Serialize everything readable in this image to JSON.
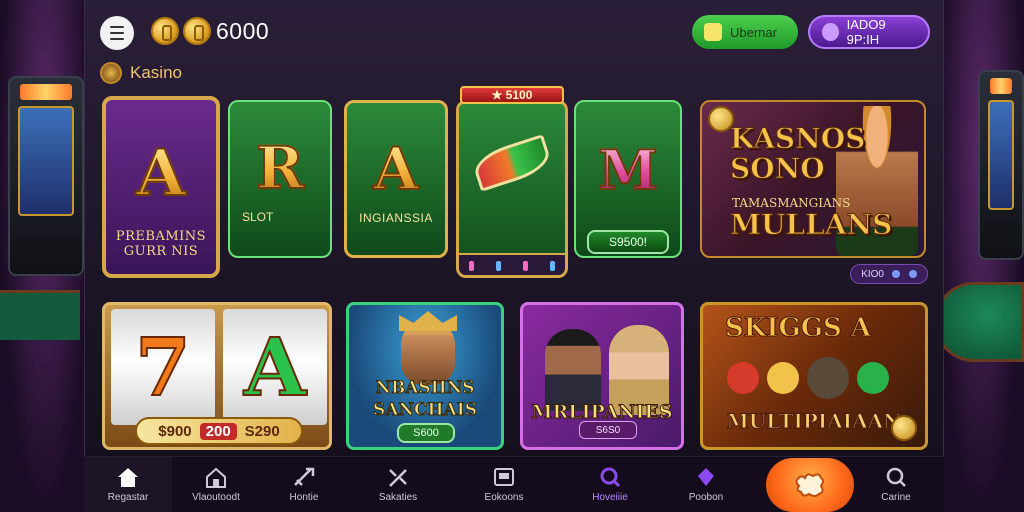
{
  "header": {
    "balance": "6000",
    "pill_green_label": "Ubernar",
    "pill_purple_label": "IADO9 9P:IH"
  },
  "section": {
    "title": "Kasino"
  },
  "cards_row1": [
    {
      "letter": "A",
      "caption_line1": "PREBAMINS",
      "caption_line2": "GURR NIS"
    },
    {
      "letter": "R",
      "caption": "SLOT"
    },
    {
      "letter": "A",
      "caption": "INGIANSSIA"
    },
    {
      "badge": "★ 5100",
      "button": ""
    },
    {
      "letter": "M",
      "button": "S9500!"
    },
    {
      "title_line1": "KASNOS",
      "title_line2": "SONO",
      "subtitle": "TAMASMANGIANS",
      "title_line3": "MULLANS"
    }
  ],
  "small_tag": {
    "label": "KIO0"
  },
  "cards_row2": [
    {
      "bar_left": "$900",
      "bar_mid": "200",
      "bar_right": "S290"
    },
    {
      "title_line1": "NBASIINS",
      "title_line2": "SANCHAIS",
      "button": "S600"
    },
    {
      "title": "MRLIPANIES",
      "button": "S6S0"
    },
    {
      "title": "SKIGGS A",
      "subtitle": "MULTIPIAIAAN"
    }
  ],
  "nav": {
    "items": [
      {
        "label": "Regastar",
        "icon": "home-icon"
      },
      {
        "label": "Vlaoutoodt",
        "icon": "house-icon"
      },
      {
        "label": "Hontie",
        "icon": "sword-icon"
      },
      {
        "label": "Sakaties",
        "icon": "tools-icon"
      },
      {
        "label": "Eokoons",
        "icon": "tv-icon"
      },
      {
        "label": "Hoveiiie",
        "icon": "search-icon"
      },
      {
        "label": "Poobon",
        "icon": "crystal-icon"
      },
      {
        "label": "Carine",
        "icon": "magnifier-icon"
      }
    ]
  }
}
